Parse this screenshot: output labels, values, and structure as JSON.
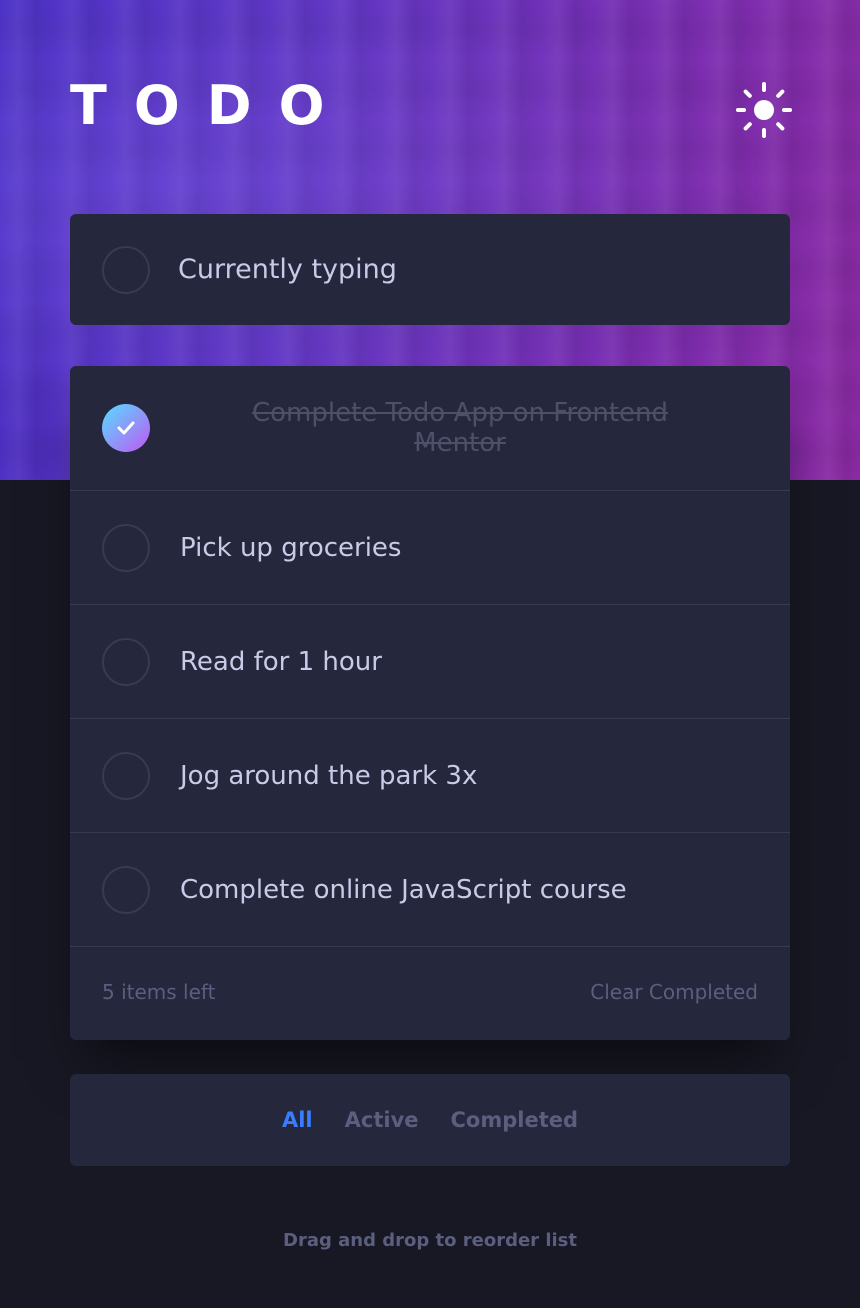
{
  "app": {
    "title": "TODO"
  },
  "theme_toggle": {
    "icon": "sun-icon"
  },
  "new_todo": {
    "value": "Currently typing"
  },
  "todos": [
    {
      "text_line1": "Complete Todo App on Frontend",
      "text_line2": "Mentor",
      "completed": true
    },
    {
      "text": "Pick up groceries",
      "completed": false
    },
    {
      "text": "Read for 1 hour",
      "completed": false
    },
    {
      "text": "Jog around the park 3x",
      "completed": false
    },
    {
      "text": "Complete online JavaScript course",
      "completed": false
    }
  ],
  "footer": {
    "items_left": "5 items left",
    "clear_label": "Clear Completed"
  },
  "filters": {
    "all": "All",
    "active": "Active",
    "completed": "Completed",
    "selected": "All"
  },
  "hint": "Drag and drop to reorder list",
  "colors": {
    "background": "#171823",
    "card": "#25273d",
    "text": "#c8cbe7",
    "muted": "#5b5e7e",
    "accent": "#3a7cfd",
    "check_gradient_start": "#55ddff",
    "check_gradient_end": "#c058f3"
  }
}
